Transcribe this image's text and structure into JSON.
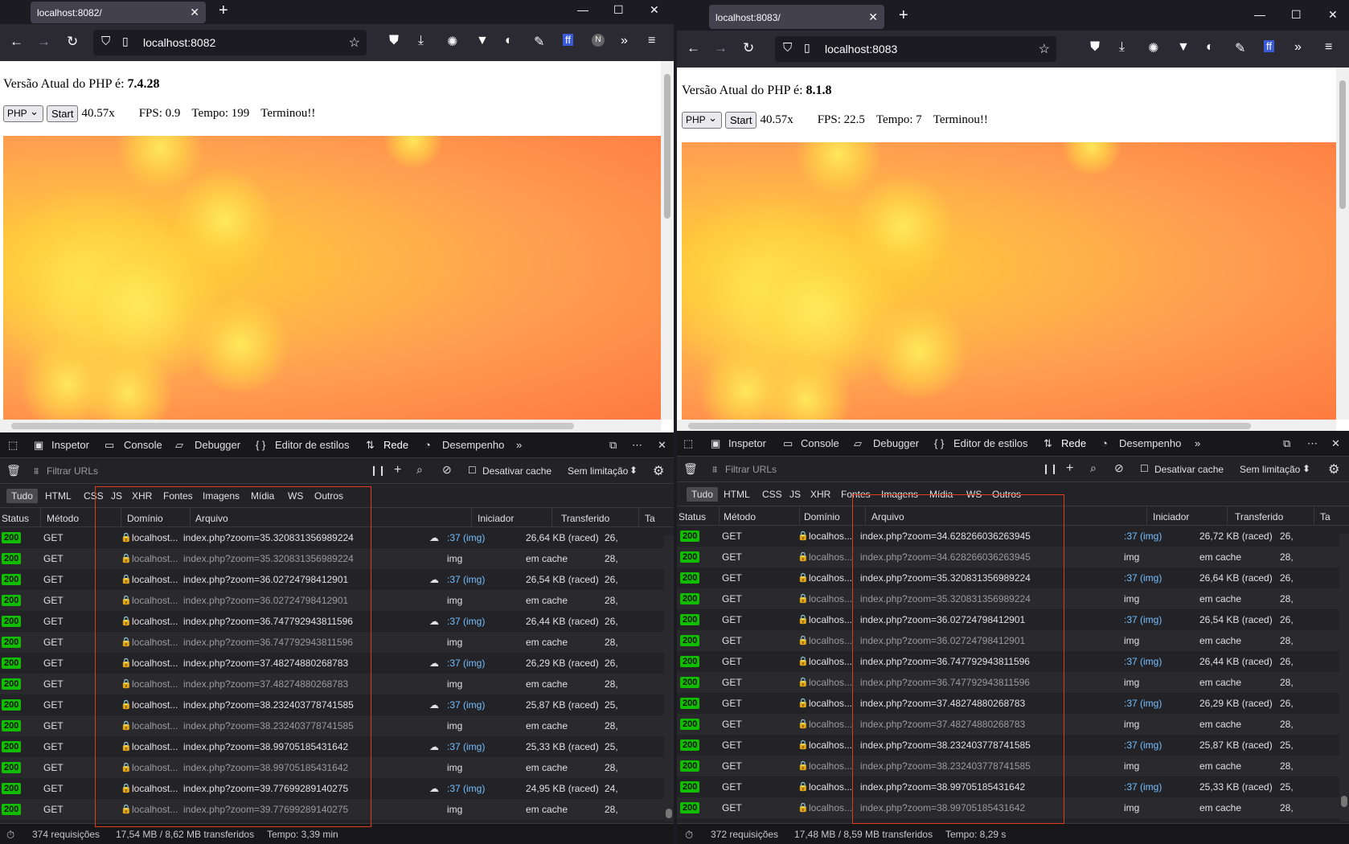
{
  "left": {
    "tab_title": "localhost:8082/",
    "url": "localhost:8082",
    "php_version_label": "Versão Atual do PHP é:",
    "php_version": "7.4.28",
    "select_value": "PHP",
    "start_label": "Start",
    "zoom": "40.57x",
    "fps": "FPS: 0.9",
    "tempo": "Tempo: 199",
    "status": "Terminou!!",
    "devtools": {
      "tabs": [
        "Inspetor",
        "Console",
        "Debugger",
        "Editor de estilos",
        "Rede",
        "Desempenho"
      ],
      "filter_placeholder": "Filtrar URLs",
      "disable_cache": "Desativar cache",
      "throttle": "Sem limitação",
      "filters": [
        "Tudo",
        "HTML",
        "CSS",
        "JS",
        "XHR",
        "Fontes",
        "Imagens",
        "Mídia",
        "WS",
        "Outros"
      ],
      "headers": [
        "Status",
        "Método",
        "Domínio",
        "Arquivo",
        "Iniciador",
        "Transferido",
        "Ta"
      ],
      "rows": [
        {
          "status": "200",
          "method": "GET",
          "domain": "localhost...",
          "file": "index.php?zoom=35.320831356989224",
          "init": ":37 (img)",
          "transfer": "26,64 KB (raced)",
          "ta": "26,",
          "cached": false
        },
        {
          "status": "200",
          "method": "GET",
          "domain": "localhost...",
          "file": "index.php?zoom=35.320831356989224",
          "init": "img",
          "transfer": "em cache",
          "ta": "28,",
          "cached": true
        },
        {
          "status": "200",
          "method": "GET",
          "domain": "localhost...",
          "file": "index.php?zoom=36.02724798412901",
          "init": ":37 (img)",
          "transfer": "26,54 KB (raced)",
          "ta": "26,",
          "cached": false
        },
        {
          "status": "200",
          "method": "GET",
          "domain": "localhost...",
          "file": "index.php?zoom=36.02724798412901",
          "init": "img",
          "transfer": "em cache",
          "ta": "28,",
          "cached": true
        },
        {
          "status": "200",
          "method": "GET",
          "domain": "localhost...",
          "file": "index.php?zoom=36.747792943811596",
          "init": ":37 (img)",
          "transfer": "26,44 KB (raced)",
          "ta": "26,",
          "cached": false
        },
        {
          "status": "200",
          "method": "GET",
          "domain": "localhost...",
          "file": "index.php?zoom=36.747792943811596",
          "init": "img",
          "transfer": "em cache",
          "ta": "28,",
          "cached": true
        },
        {
          "status": "200",
          "method": "GET",
          "domain": "localhost...",
          "file": "index.php?zoom=37.48274880268783",
          "init": ":37 (img)",
          "transfer": "26,29 KB (raced)",
          "ta": "26,",
          "cached": false
        },
        {
          "status": "200",
          "method": "GET",
          "domain": "localhost...",
          "file": "index.php?zoom=37.48274880268783",
          "init": "img",
          "transfer": "em cache",
          "ta": "28,",
          "cached": true
        },
        {
          "status": "200",
          "method": "GET",
          "domain": "localhost...",
          "file": "index.php?zoom=38.232403778741585",
          "init": ":37 (img)",
          "transfer": "25,87 KB (raced)",
          "ta": "25,",
          "cached": false
        },
        {
          "status": "200",
          "method": "GET",
          "domain": "localhost...",
          "file": "index.php?zoom=38.232403778741585",
          "init": "img",
          "transfer": "em cache",
          "ta": "28,",
          "cached": true
        },
        {
          "status": "200",
          "method": "GET",
          "domain": "localhost...",
          "file": "index.php?zoom=38.99705185431642",
          "init": ":37 (img)",
          "transfer": "25,33 KB (raced)",
          "ta": "25,",
          "cached": false
        },
        {
          "status": "200",
          "method": "GET",
          "domain": "localhost...",
          "file": "index.php?zoom=38.99705185431642",
          "init": "img",
          "transfer": "em cache",
          "ta": "28,",
          "cached": true
        },
        {
          "status": "200",
          "method": "GET",
          "domain": "localhost...",
          "file": "index.php?zoom=39.77699289140275",
          "init": ":37 (img)",
          "transfer": "24,95 KB (raced)",
          "ta": "24,",
          "cached": false
        },
        {
          "status": "200",
          "method": "GET",
          "domain": "localhost...",
          "file": "index.php?zoom=39.77699289140275",
          "init": "img",
          "transfer": "em cache",
          "ta": "28,",
          "cached": true
        }
      ],
      "summary_requests": "374 requisições",
      "summary_size": "17,54 MB / 8,62 MB transferidos",
      "summary_time": "Tempo: 3,39 min"
    }
  },
  "right": {
    "tab_title": "localhost:8083/",
    "url": "localhost:8083",
    "php_version_label": "Versão Atual do PHP é:",
    "php_version": "8.1.8",
    "select_value": "PHP",
    "start_label": "Start",
    "zoom": "40.57x",
    "fps": "FPS: 22.5",
    "tempo": "Tempo: 7",
    "status": "Terminou!!",
    "devtools": {
      "tabs": [
        "Inspetor",
        "Console",
        "Debugger",
        "Editor de estilos",
        "Rede",
        "Desempenho"
      ],
      "filter_placeholder": "Filtrar URLs",
      "disable_cache": "Desativar cache",
      "throttle": "Sem limitação",
      "filters": [
        "Tudo",
        "HTML",
        "CSS",
        "JS",
        "XHR",
        "Fontes",
        "Imagens",
        "Mídia",
        "WS",
        "Outros"
      ],
      "headers": [
        "Status",
        "Método",
        "Domínio",
        "Arquivo",
        "Iniciador",
        "Transferido",
        "Ta"
      ],
      "rows": [
        {
          "status": "200",
          "method": "GET",
          "domain": "localhos...",
          "file": "index.php?zoom=34.628266036263945",
          "init": ":37 (img)",
          "transfer": "26,72 KB (raced)",
          "ta": "26,",
          "cached": false
        },
        {
          "status": "200",
          "method": "GET",
          "domain": "localhos...",
          "file": "index.php?zoom=34.628266036263945",
          "init": "img",
          "transfer": "em cache",
          "ta": "28,",
          "cached": true
        },
        {
          "status": "200",
          "method": "GET",
          "domain": "localhos...",
          "file": "index.php?zoom=35.320831356989224",
          "init": ":37 (img)",
          "transfer": "26,64 KB (raced)",
          "ta": "26,",
          "cached": false
        },
        {
          "status": "200",
          "method": "GET",
          "domain": "localhos...",
          "file": "index.php?zoom=35.320831356989224",
          "init": "img",
          "transfer": "em cache",
          "ta": "28,",
          "cached": true
        },
        {
          "status": "200",
          "method": "GET",
          "domain": "localhos...",
          "file": "index.php?zoom=36.02724798412901",
          "init": ":37 (img)",
          "transfer": "26,54 KB (raced)",
          "ta": "26,",
          "cached": false
        },
        {
          "status": "200",
          "method": "GET",
          "domain": "localhos...",
          "file": "index.php?zoom=36.02724798412901",
          "init": "img",
          "transfer": "em cache",
          "ta": "28,",
          "cached": true
        },
        {
          "status": "200",
          "method": "GET",
          "domain": "localhos...",
          "file": "index.php?zoom=36.747792943811596",
          "init": ":37 (img)",
          "transfer": "26,44 KB (raced)",
          "ta": "26,",
          "cached": false
        },
        {
          "status": "200",
          "method": "GET",
          "domain": "localhos...",
          "file": "index.php?zoom=36.747792943811596",
          "init": "img",
          "transfer": "em cache",
          "ta": "28,",
          "cached": true
        },
        {
          "status": "200",
          "method": "GET",
          "domain": "localhos...",
          "file": "index.php?zoom=37.48274880268783",
          "init": ":37 (img)",
          "transfer": "26,29 KB (raced)",
          "ta": "26,",
          "cached": false
        },
        {
          "status": "200",
          "method": "GET",
          "domain": "localhos...",
          "file": "index.php?zoom=37.48274880268783",
          "init": "img",
          "transfer": "em cache",
          "ta": "28,",
          "cached": true
        },
        {
          "status": "200",
          "method": "GET",
          "domain": "localhos...",
          "file": "index.php?zoom=38.232403778741585",
          "init": ":37 (img)",
          "transfer": "25,87 KB (raced)",
          "ta": "25,",
          "cached": false
        },
        {
          "status": "200",
          "method": "GET",
          "domain": "localhos...",
          "file": "index.php?zoom=38.232403778741585",
          "init": "img",
          "transfer": "em cache",
          "ta": "28,",
          "cached": true
        },
        {
          "status": "200",
          "method": "GET",
          "domain": "localhos...",
          "file": "index.php?zoom=38.99705185431642",
          "init": ":37 (img)",
          "transfer": "25,33 KB (raced)",
          "ta": "25,",
          "cached": false
        },
        {
          "status": "200",
          "method": "GET",
          "domain": "localhos...",
          "file": "index.php?zoom=38.99705185431642",
          "init": "img",
          "transfer": "em cache",
          "ta": "28,",
          "cached": true
        }
      ],
      "summary_requests": "372 requisições",
      "summary_size": "17,48 MB / 8,59 MB transferidos",
      "summary_time": "Tempo: 8,29 s"
    }
  },
  "colors": {
    "accent": "#0a84ff",
    "status_ok": "#12bc00",
    "annotation": "#e23c1e",
    "fractal_main": "#ffa050"
  }
}
